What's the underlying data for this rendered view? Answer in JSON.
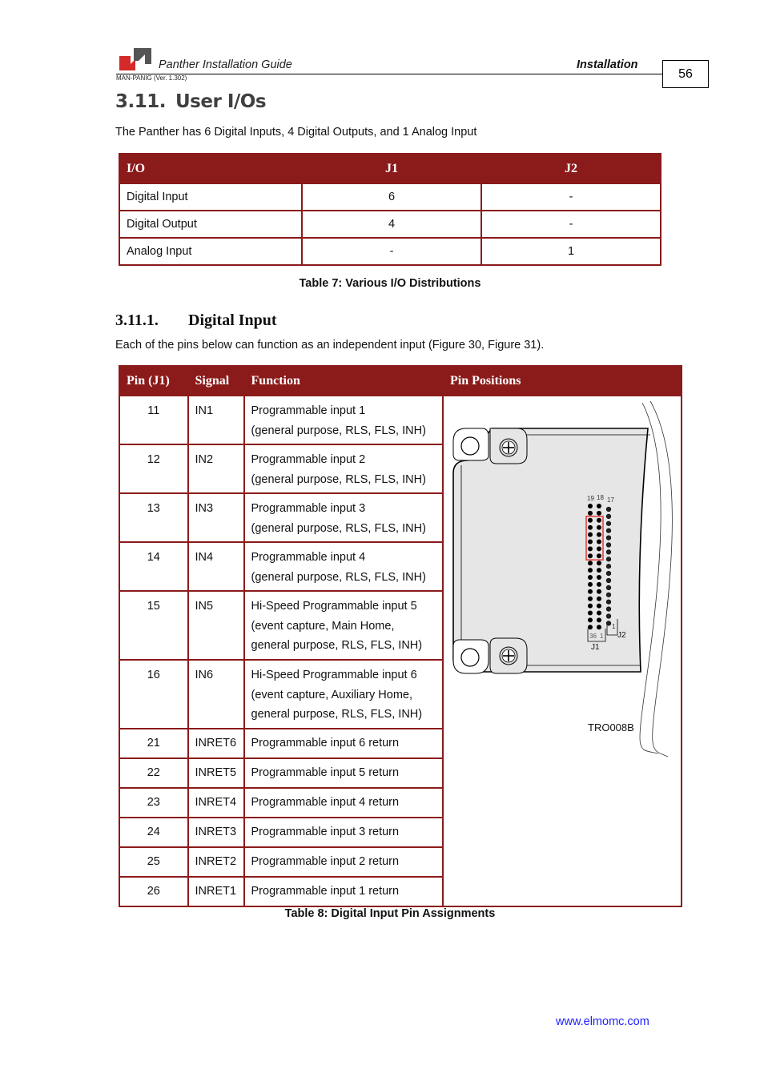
{
  "header": {
    "doc_title": "Panther Installation Guide",
    "section": "Installation",
    "version": "MAN-PANIG (Ver. 1.302)",
    "page_number": "56",
    "logo": "elmo-logo"
  },
  "section": {
    "number": "3.11.",
    "title": "User I/Os",
    "intro": "The Panther has 6 Digital Inputs, 4 Digital Outputs, and 1 Analog Input"
  },
  "table7": {
    "headers": [
      "I/O",
      "J1",
      "J2"
    ],
    "rows": [
      [
        "Digital Input",
        "6",
        "-"
      ],
      [
        "Digital Output",
        "4",
        "-"
      ],
      [
        "Analog Input",
        "-",
        "1"
      ]
    ],
    "caption": "Table 7: Various I/O Distributions"
  },
  "subsection": {
    "number": "3.11.1.",
    "title": "Digital Input",
    "intro": "Each of the pins below can function as an independent input (Figure 30, Figure 31)."
  },
  "table8": {
    "headers": [
      "Pin (J1)",
      "Signal",
      "Function",
      "Pin Positions"
    ],
    "rows": [
      {
        "pin": "11",
        "signal": "IN1",
        "function": [
          "Programmable input 1",
          "(general purpose, RLS, FLS, INH)"
        ]
      },
      {
        "pin": "12",
        "signal": "IN2",
        "function": [
          "Programmable input 2",
          "(general purpose, RLS, FLS, INH)"
        ]
      },
      {
        "pin": "13",
        "signal": "IN3",
        "function": [
          "Programmable input 3",
          "(general purpose, RLS, FLS, INH)"
        ]
      },
      {
        "pin": "14",
        "signal": "IN4",
        "function": [
          "Programmable input 4",
          "(general purpose, RLS, FLS, INH)"
        ]
      },
      {
        "pin": "15",
        "signal": "IN5",
        "function": [
          "Hi-Speed Programmable input 5",
          "(event capture, Main Home,",
          "general purpose, RLS, FLS, INH)"
        ]
      },
      {
        "pin": "16",
        "signal": "IN6",
        "function": [
          "Hi-Speed Programmable input 6",
          "(event capture, Auxiliary Home,",
          "general purpose, RLS, FLS, INH)"
        ]
      },
      {
        "pin": "21",
        "signal": "INRET6",
        "function": [
          "Programmable input 6 return"
        ]
      },
      {
        "pin": "22",
        "signal": "INRET5",
        "function": [
          "Programmable input 5 return"
        ]
      },
      {
        "pin": "23",
        "signal": "INRET4",
        "function": [
          "Programmable input 4 return"
        ]
      },
      {
        "pin": "24",
        "signal": "INRET3",
        "function": [
          "Programmable input 3 return"
        ]
      },
      {
        "pin": "25",
        "signal": "INRET2",
        "function": [
          "Programmable input 2 return"
        ]
      },
      {
        "pin": "26",
        "signal": "INRET1",
        "function": [
          "Programmable input 1 return"
        ]
      }
    ],
    "figure": {
      "label_19": "19",
      "label_18": "18",
      "label_17": "17",
      "label_36": "36",
      "label_1_j1": "1",
      "label_1_j2": "1",
      "connector_j1": "J1",
      "connector_j2": "J2",
      "figure_id": "TRO008B",
      "j1_rows": 18,
      "j2_pins": 17,
      "highlighted_rows": [
        3,
        8
      ]
    },
    "caption": "Table 8: Digital Input Pin Assignments"
  },
  "footer": {
    "website": "www.elmomc.com"
  },
  "colors": {
    "table_header": "#8b1a1a",
    "link": "#1f1fff",
    "highlight_box": "#e02020"
  }
}
